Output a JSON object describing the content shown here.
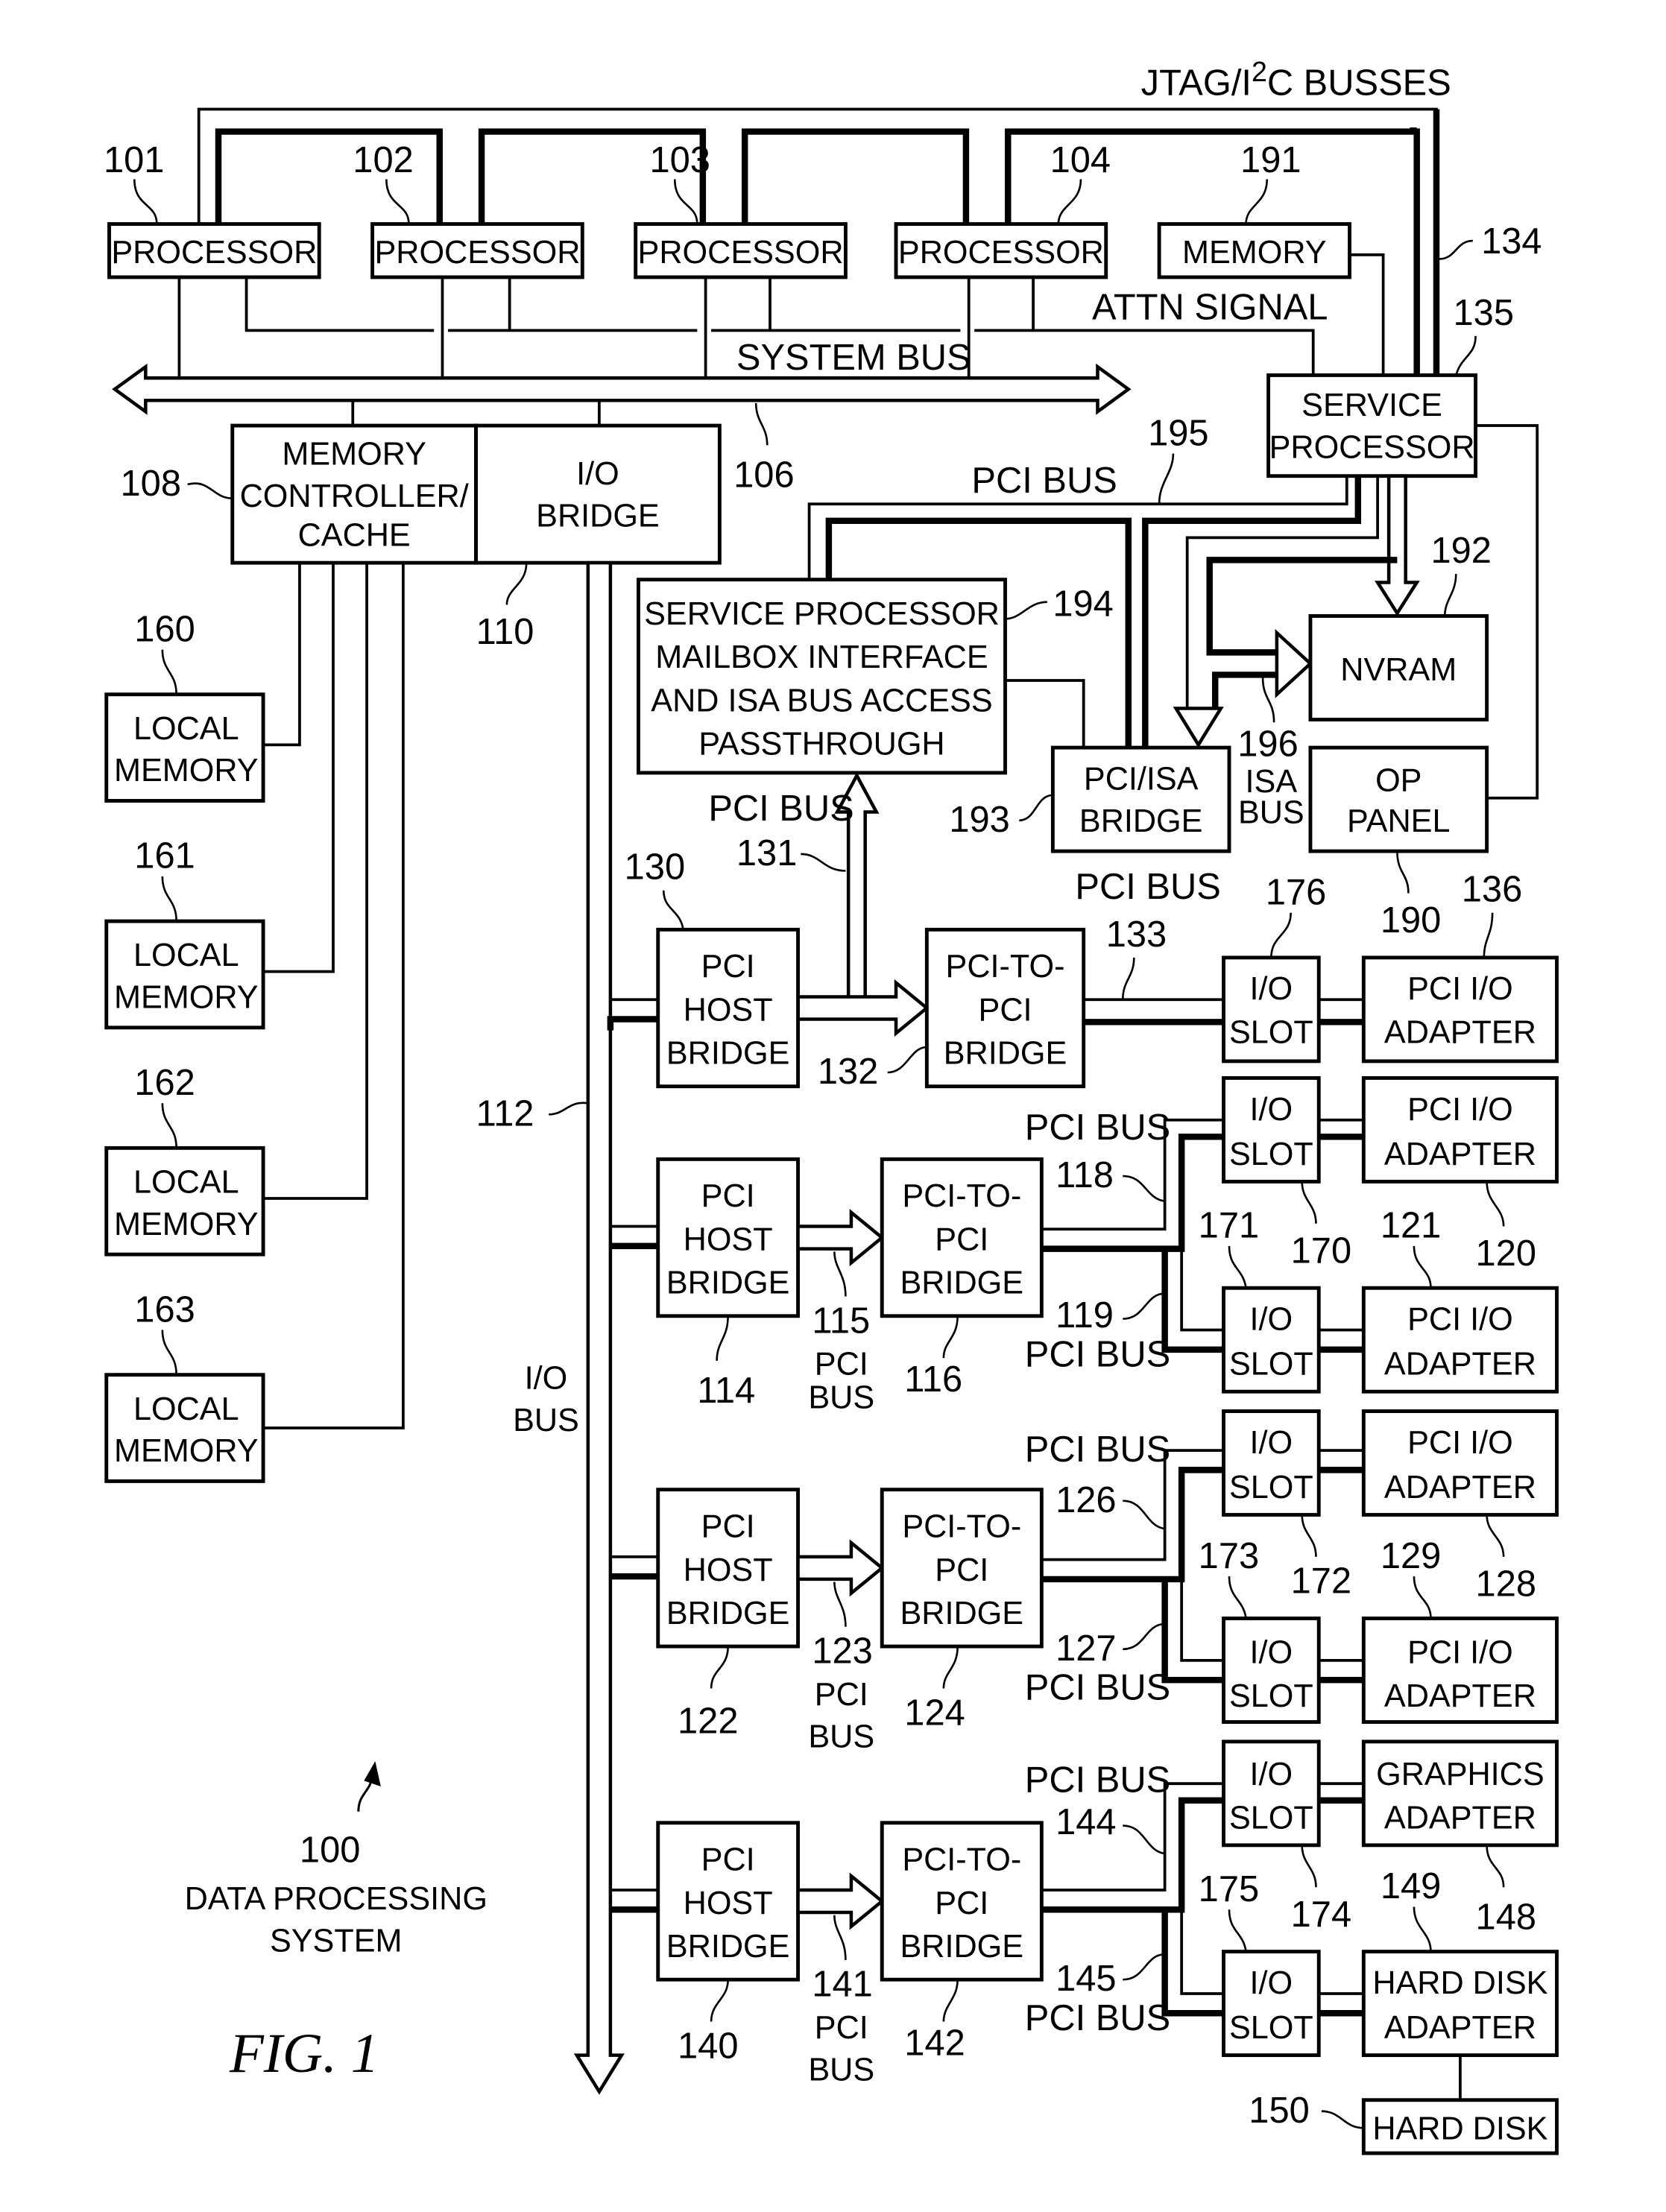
{
  "figure": {
    "caption": "FIG. 1",
    "system_ref": "100",
    "system_name_line1": "DATA PROCESSING",
    "system_name_line2": "SYSTEM"
  },
  "top": {
    "jtag_label_prefix": "JTAG/I",
    "jtag_label_sup": "2",
    "jtag_label_suffix": "C BUSSES",
    "jtag_ref": "134",
    "attn_signal": "ATTN SIGNAL",
    "system_bus": "SYSTEM BUS",
    "system_bus_ref": "106"
  },
  "processors": [
    {
      "ref": "101",
      "label": "PROCESSOR"
    },
    {
      "ref": "102",
      "label": "PROCESSOR"
    },
    {
      "ref": "103",
      "label": "PROCESSOR"
    },
    {
      "ref": "104",
      "label": "PROCESSOR"
    }
  ],
  "memory191": {
    "ref": "191",
    "label": "MEMORY"
  },
  "service_processor": {
    "ref": "135",
    "line1": "SERVICE",
    "line2": "PROCESSOR"
  },
  "mem_ctrl": {
    "ref": "108",
    "line1": "MEMORY",
    "line2": "CONTROLLER/",
    "line3": "CACHE"
  },
  "io_bridge": {
    "ref": "110",
    "line1": "I/O",
    "line2": "BRIDGE"
  },
  "local_memories": [
    {
      "ref": "160",
      "line1": "LOCAL",
      "line2": "MEMORY"
    },
    {
      "ref": "161",
      "line1": "LOCAL",
      "line2": "MEMORY"
    },
    {
      "ref": "162",
      "line1": "LOCAL",
      "line2": "MEMORY"
    },
    {
      "ref": "163",
      "line1": "LOCAL",
      "line2": "MEMORY"
    }
  ],
  "io_bus": {
    "ref": "112",
    "line1": "I/O",
    "line2": "BUS"
  },
  "sp_mailbox": {
    "ref": "194",
    "line1": "SERVICE PROCESSOR",
    "line2": "MAILBOX INTERFACE",
    "line3": "AND ISA BUS ACCESS",
    "line4": "PASSTHROUGH"
  },
  "pci_bus_195": {
    "label": "PCI BUS",
    "ref": "195"
  },
  "nvram": {
    "ref": "192",
    "label": "NVRAM"
  },
  "pci_isa_bridge": {
    "ref": "193",
    "line1": "PCI/ISA",
    "line2": "BRIDGE"
  },
  "isa_bus": {
    "ref": "196",
    "line1": "ISA",
    "line2": "BUS"
  },
  "op_panel": {
    "ref": "190",
    "line1": "OP",
    "line2": "PANEL"
  },
  "pci_bus_131": {
    "label": "PCI BUS",
    "ref": "131"
  },
  "pci_bus_133": {
    "label": "PCI BUS",
    "ref": "133"
  },
  "host_bridges": [
    {
      "ref": "130",
      "line1": "PCI",
      "line2": "HOST",
      "line3": "BRIDGE"
    },
    {
      "ref": "114",
      "line1": "PCI",
      "line2": "HOST",
      "line3": "BRIDGE"
    },
    {
      "ref": "122",
      "line1": "PCI",
      "line2": "HOST",
      "line3": "BRIDGE"
    },
    {
      "ref": "140",
      "line1": "PCI",
      "line2": "HOST",
      "line3": "BRIDGE"
    }
  ],
  "p2p_bridges": [
    {
      "ref": "132",
      "line1": "PCI-TO-",
      "line2": "PCI",
      "line3": "BRIDGE"
    },
    {
      "ref": "116",
      "line1": "PCI-TO-",
      "line2": "PCI",
      "line3": "BRIDGE"
    },
    {
      "ref": "124",
      "line1": "PCI-TO-",
      "line2": "PCI",
      "line3": "BRIDGE"
    },
    {
      "ref": "142",
      "line1": "PCI-TO-",
      "line2": "PCI",
      "line3": "BRIDGE"
    }
  ],
  "host_buses": [
    {
      "ref": "115",
      "line1": "PCI",
      "line2": "BUS"
    },
    {
      "ref": "123",
      "line1": "PCI",
      "line2": "BUS"
    },
    {
      "ref": "141",
      "line1": "PCI",
      "line2": "BUS"
    }
  ],
  "secondary_buses": [
    {
      "ref": "118",
      "label": "PCI BUS"
    },
    {
      "ref": "119",
      "label": "PCI BUS"
    },
    {
      "ref": "126",
      "label": "PCI BUS"
    },
    {
      "ref": "127",
      "label": "PCI BUS"
    },
    {
      "ref": "144",
      "label": "PCI BUS"
    },
    {
      "ref": "145",
      "label": "PCI BUS"
    }
  ],
  "io_slots": [
    {
      "ref": "176",
      "line1": "I/O",
      "line2": "SLOT"
    },
    {
      "ref": "170",
      "line1": "I/O",
      "line2": "SLOT"
    },
    {
      "ref": "171",
      "line1": "I/O",
      "line2": "SLOT"
    },
    {
      "ref": "172",
      "line1": "I/O",
      "line2": "SLOT"
    },
    {
      "ref": "173",
      "line1": "I/O",
      "line2": "SLOT"
    },
    {
      "ref": "174",
      "line1": "I/O",
      "line2": "SLOT"
    },
    {
      "ref": "175",
      "line1": "I/O",
      "line2": "SLOT"
    }
  ],
  "adapters": [
    {
      "ref": "136",
      "line1": "PCI I/O",
      "line2": "ADAPTER"
    },
    {
      "ref": "120",
      "line1": "PCI I/O",
      "line2": "ADAPTER"
    },
    {
      "ref": "121",
      "line1": "PCI I/O",
      "line2": "ADAPTER"
    },
    {
      "ref": "128",
      "line1": "PCI I/O",
      "line2": "ADAPTER"
    },
    {
      "ref": "129",
      "line1": "PCI I/O",
      "line2": "ADAPTER"
    },
    {
      "ref": "148",
      "line1": "GRAPHICS",
      "line2": "ADAPTER"
    },
    {
      "ref": "149",
      "line1": "HARD DISK",
      "line2": "ADAPTER"
    }
  ],
  "hard_disk": {
    "ref": "150",
    "label": "HARD DISK"
  }
}
